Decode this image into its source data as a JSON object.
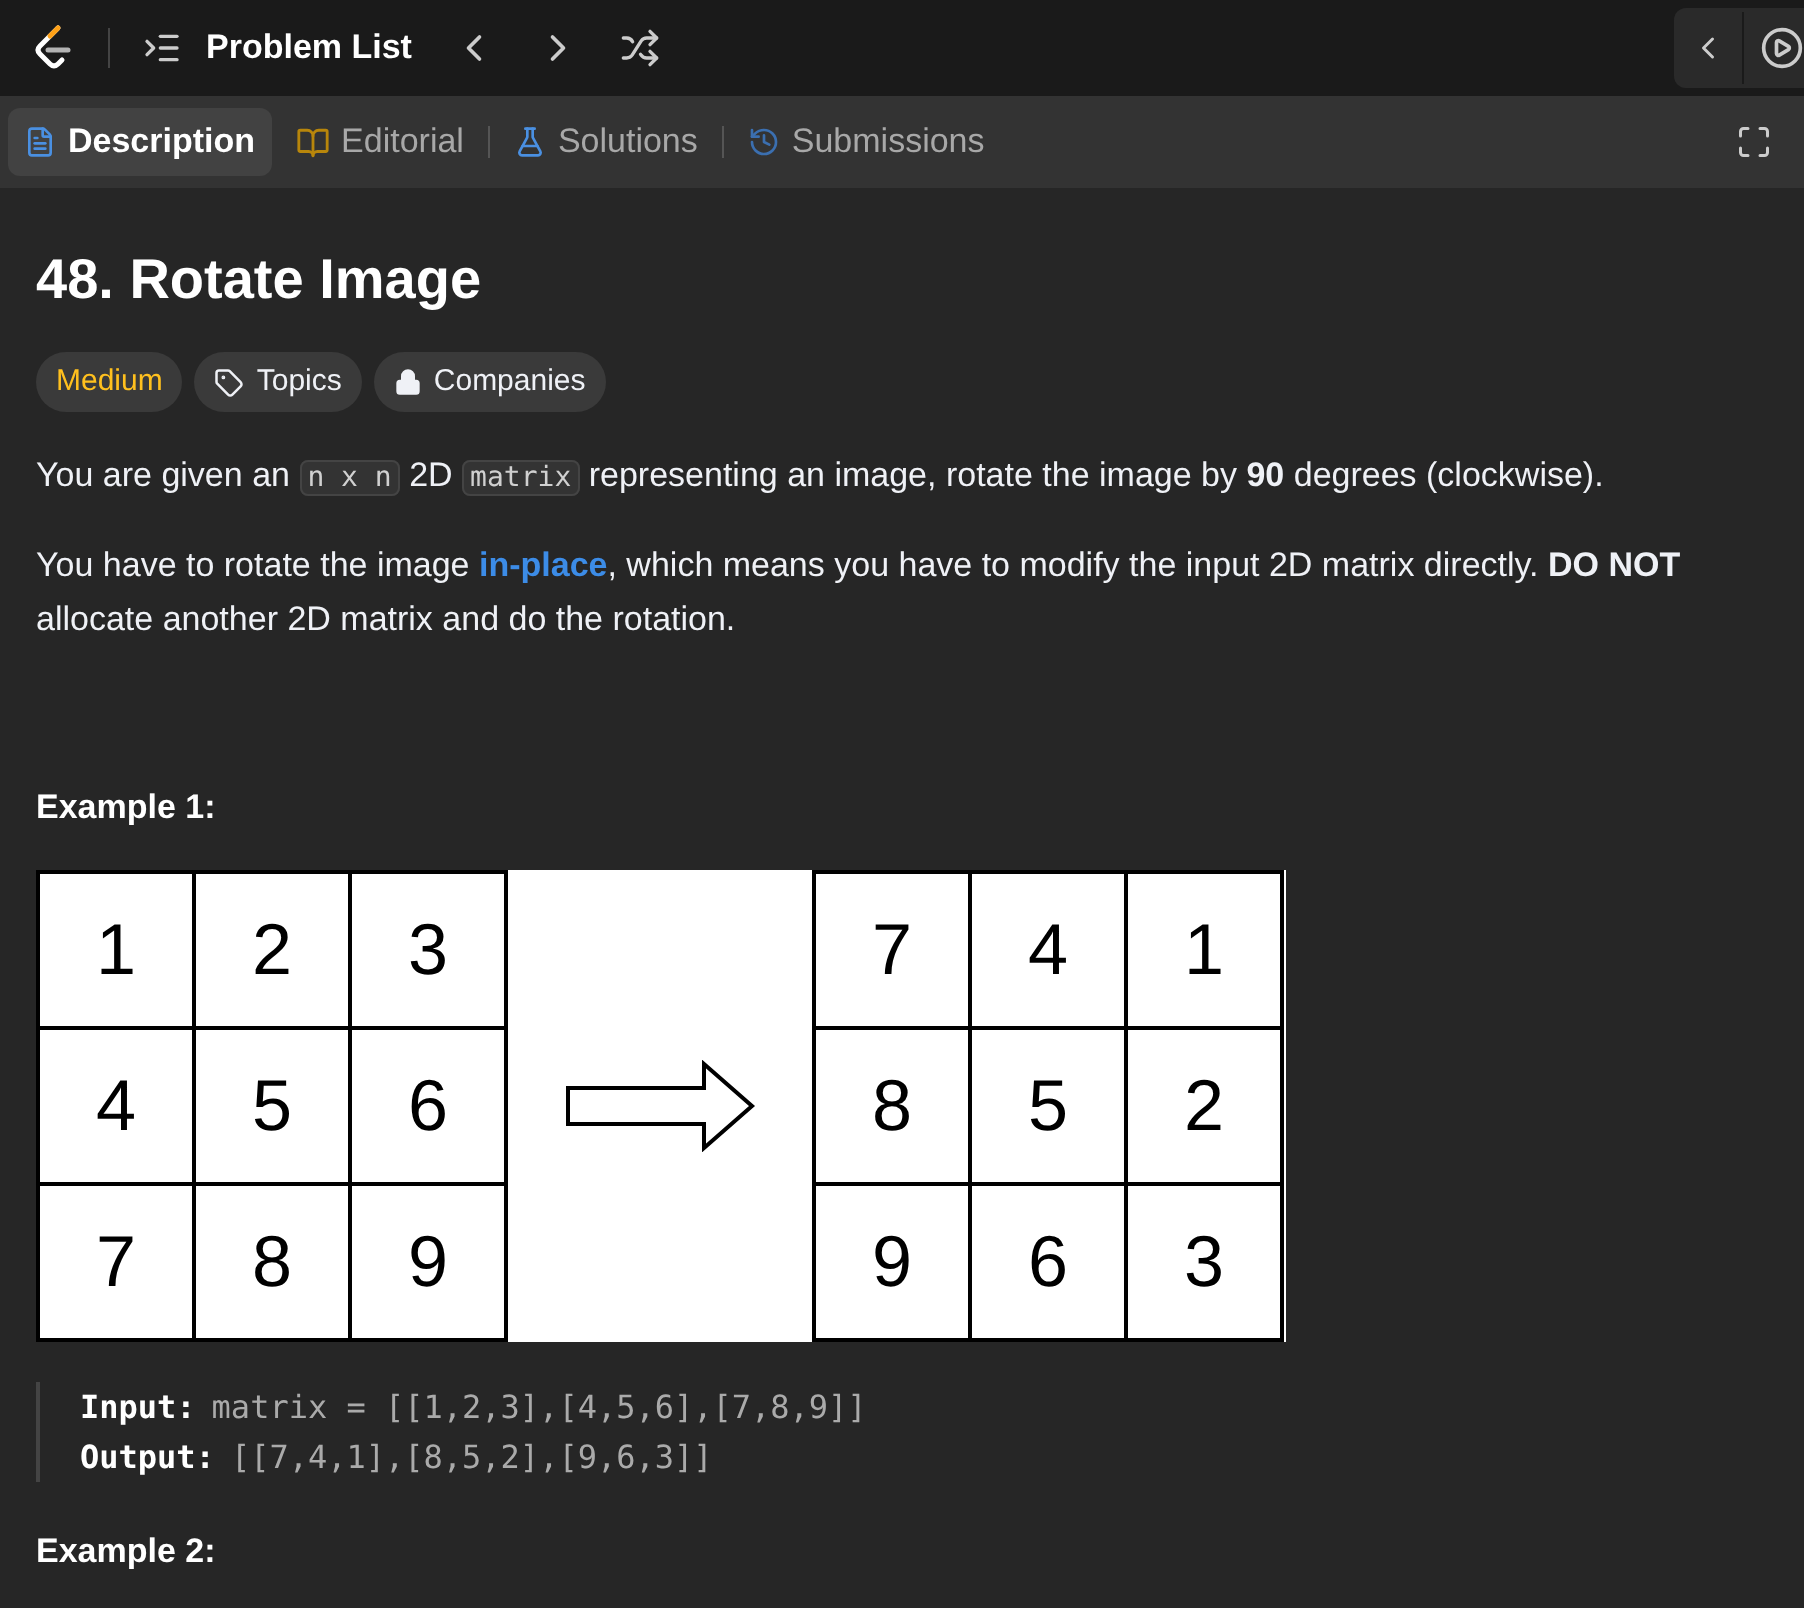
{
  "topbar": {
    "title": "Problem List"
  },
  "tabs": [
    {
      "label": "Description",
      "selected": true,
      "kind": "description"
    },
    {
      "label": "Editorial",
      "selected": false,
      "kind": "editorial"
    },
    {
      "label": "Solutions",
      "selected": false,
      "kind": "solutions"
    },
    {
      "label": "Submissions",
      "selected": false,
      "kind": "submissions"
    }
  ],
  "problem": {
    "title": "48. Rotate Image",
    "tags": [
      {
        "label": "Medium",
        "kind": "difficulty"
      },
      {
        "label": "Topics",
        "kind": "topics"
      },
      {
        "label": "Companies",
        "kind": "companies"
      }
    ],
    "paragraphs": [
      [
        {
          "kind": "text",
          "text": "You are given an "
        },
        {
          "kind": "code",
          "text": "n x n"
        },
        {
          "kind": "text",
          "text": " 2D "
        },
        {
          "kind": "code",
          "text": "matrix"
        },
        {
          "kind": "text",
          "text": " representing an image, rotate the image by **90** degrees (clockwise)."
        }
      ],
      [
        {
          "kind": "text",
          "text": "You have to rotate the image "
        },
        {
          "kind": "link",
          "text": "in-place"
        },
        {
          "kind": "text",
          "text": ", which means you have to modify the input 2D matrix directly. **DO NOT** allocate another 2D matrix and do the rotation."
        }
      ]
    ],
    "examples": [
      {
        "title": "Example 1:",
        "input_matrix": [
          [
            "1",
            "2",
            "3"
          ],
          [
            "4",
            "5",
            "6"
          ],
          [
            "7",
            "8",
            "9"
          ]
        ],
        "output_matrix": [
          [
            "7",
            "4",
            "1"
          ],
          [
            "8",
            "5",
            "2"
          ],
          [
            "9",
            "6",
            "3"
          ]
        ],
        "lines": [
          {
            "label": "Input:",
            "value": "matrix = [[1,2,3],[4,5,6],[7,8,9]]"
          },
          {
            "label": "Output:",
            "value": "[[7,4,1],[8,5,2],[9,6,3]]"
          }
        ]
      },
      {
        "title": "Example 2:"
      }
    ]
  }
}
